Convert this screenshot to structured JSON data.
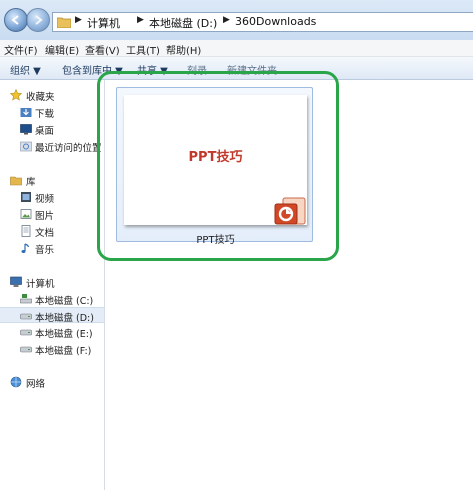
{
  "address": {
    "crumbs": [
      "计算机",
      "本地磁盘 (D:)",
      "360Downloads"
    ]
  },
  "menu": {
    "items": [
      "文件(F)",
      "编辑(E)",
      "查看(V)",
      "工具(T)",
      "帮助(H)"
    ]
  },
  "toolbar": {
    "organize": "组织 ▼",
    "include": "包含到库中 ▼",
    "share": "共享 ▼",
    "burn": "刻录",
    "new_folder": "新建文件夹"
  },
  "sidebar": {
    "favorites": {
      "label": "收藏夹",
      "items": [
        "下载",
        "桌面",
        "最近访问的位置"
      ]
    },
    "libraries": {
      "label": "库",
      "items": [
        "视频",
        "图片",
        "文档",
        "音乐"
      ]
    },
    "computer": {
      "label": "计算机",
      "drives": [
        "本地磁盘 (C:)",
        "本地磁盘 (D:)",
        "本地磁盘 (E:)",
        "本地磁盘 (F:)"
      ]
    },
    "network": {
      "label": "网络"
    }
  },
  "content": {
    "file": {
      "thumbnail_title": "PPT技巧",
      "name": "PPT技巧"
    },
    "highlight_color": "#2aa54a"
  }
}
